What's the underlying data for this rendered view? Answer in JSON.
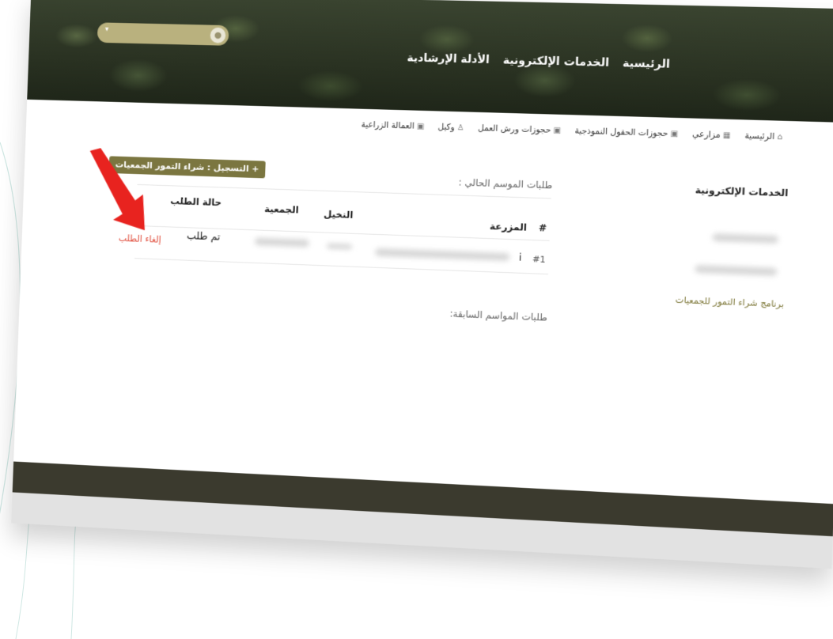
{
  "header": {
    "nav": [
      "الرئيسية",
      "الخدمات الإلكترونية",
      "الأدلة الإرشادية"
    ]
  },
  "breadcrumbs": [
    {
      "label": "الرئيسية",
      "icon": "home-icon"
    },
    {
      "label": "مزارعي",
      "icon": "farm-icon"
    },
    {
      "label": "حجوزات الحقول النموذجية",
      "icon": "calendar-icon"
    },
    {
      "label": "حجوزات ورش العمل",
      "icon": "calendar-icon"
    },
    {
      "label": "وكيل",
      "icon": "user-icon"
    },
    {
      "label": "العمالة الزراعية",
      "icon": "calendar-icon"
    }
  ],
  "sidebar": {
    "title": "الخدمات الإلكترونية",
    "active_link": "برنامج شراء التمور للجمعيات"
  },
  "main": {
    "register_button": "+ التسجيل : شراء التمور الجمعيات",
    "current_season_title": "طلبات الموسم الحالي :",
    "previous_seasons_title": "طلبات المواسم السابقة:",
    "table": {
      "headers": {
        "index": "#",
        "farm": "المزرعة",
        "palms": "النخيل",
        "association": "الجمعية",
        "status": "حالة الطلب"
      },
      "rows": [
        {
          "index": "#1",
          "farm_suffix": "i",
          "status": "تم طلب",
          "action": "إلغاء الطلب"
        }
      ]
    }
  },
  "colors": {
    "accent": "#7b7640",
    "cancel": "#e04b3a",
    "footer": "#3b3a2e",
    "annotation_arrow": "#e8231f"
  }
}
